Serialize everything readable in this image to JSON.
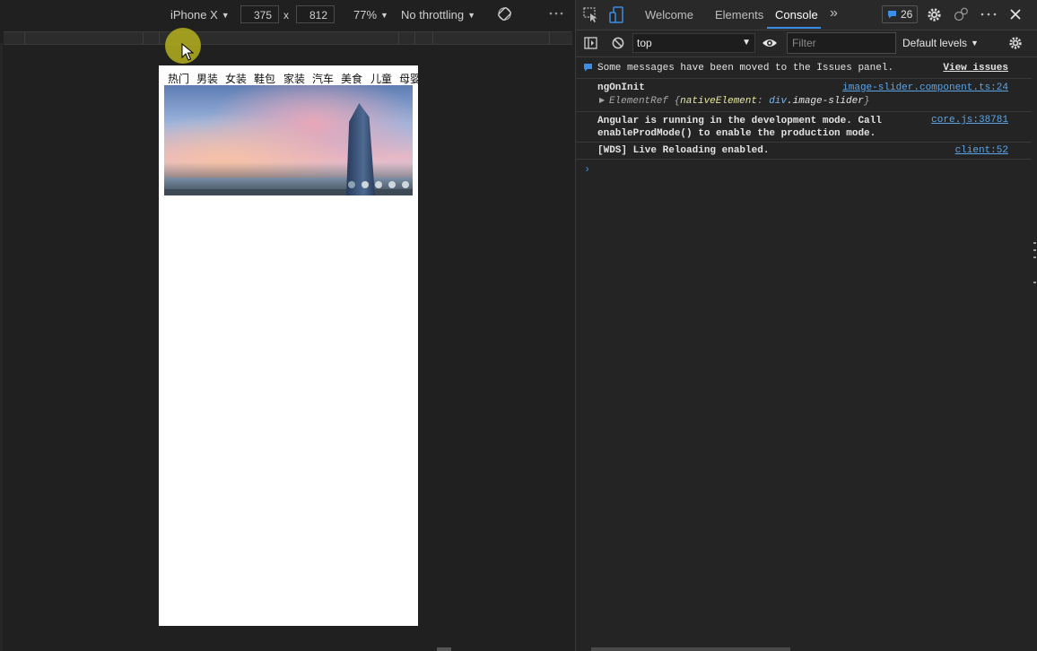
{
  "emulation": {
    "device": "iPhone X",
    "width": "375",
    "times": "x",
    "height": "812",
    "zoom": "77%",
    "throttling": "No throttling",
    "more": "⋮"
  },
  "page": {
    "categories": [
      "热门",
      "男装",
      "女装",
      "鞋包",
      "家装",
      "汽车",
      "美食",
      "儿童",
      "母婴"
    ],
    "slider_dots": 5,
    "slider_active_dot": 0
  },
  "devtools": {
    "tabs": {
      "welcome": "Welcome",
      "elements": "Elements",
      "console": "Console",
      "more": "»"
    },
    "issues_count": "26",
    "toolbar": {
      "context": "top",
      "filter_placeholder": "Filter",
      "levels": "Default levels"
    },
    "messages": [
      {
        "text": "Some messages have been moved to the Issues panel.",
        "source": "View issues"
      },
      {
        "text": "ngOnInit",
        "source": "image-slider.component.ts:24"
      },
      {
        "text_a": "ElementRef {",
        "text_b": "nativeElement",
        "text_c": ": ",
        "text_d": "div",
        "text_e": ".image-slider",
        "text_f": "}"
      },
      {
        "text": "Angular is running in the development mode. Call\nenableProdMode() to enable the production mode.",
        "source": "core.js:38781"
      },
      {
        "text": "[WDS] Live Reloading enabled.",
        "source": "client:52"
      }
    ],
    "prompt": "›"
  },
  "colors": {
    "accent": "#3a8ee6",
    "link": "#5ba6ea",
    "background": "#202020",
    "panel": "#242424"
  }
}
